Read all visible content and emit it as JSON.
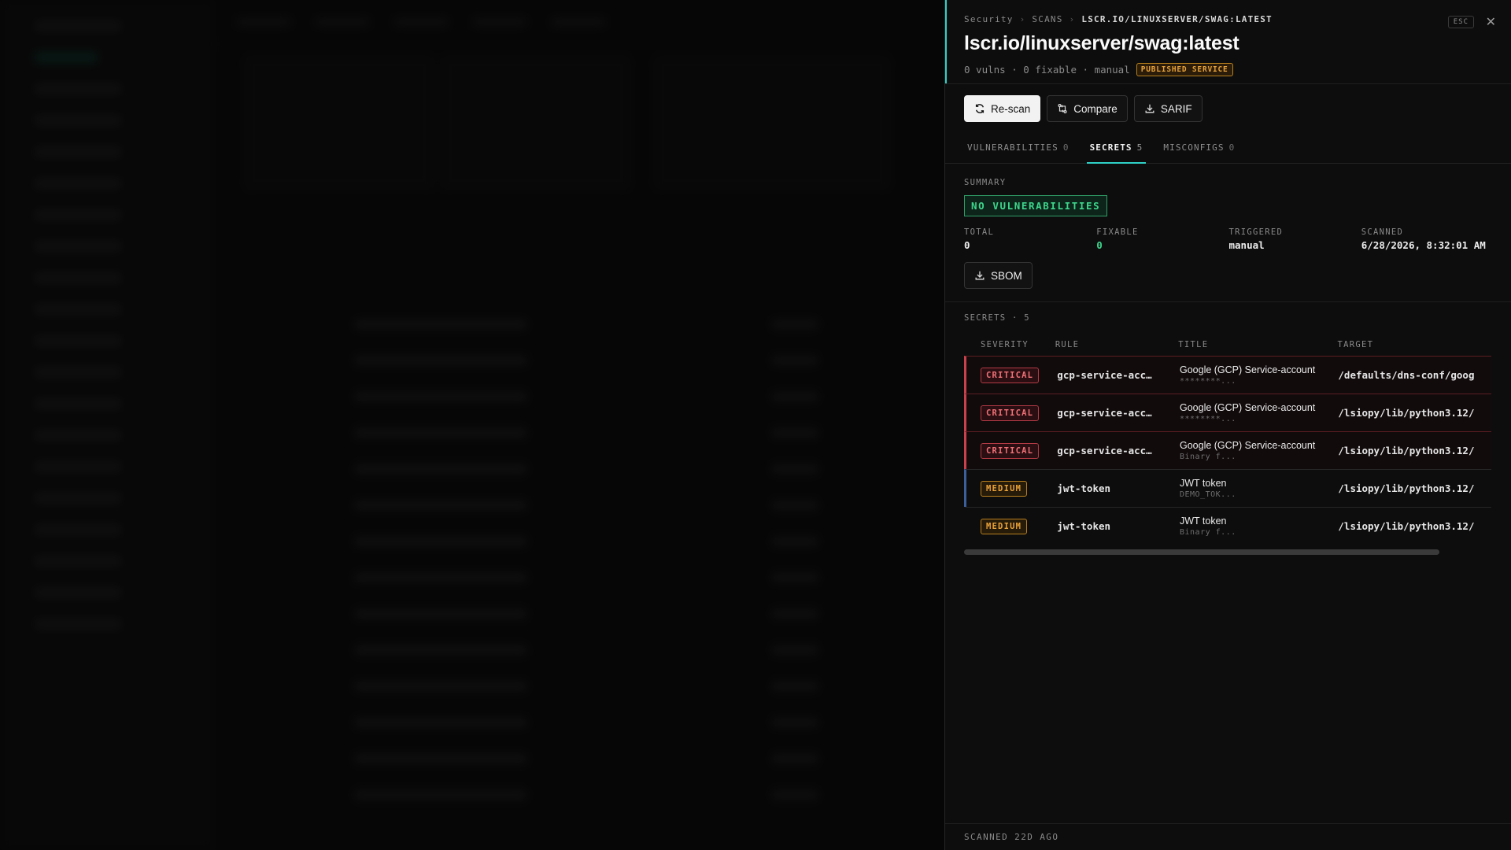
{
  "breadcrumb": {
    "root": "Security",
    "section": "SCANS",
    "current": "LSCR.IO/LINUXSERVER/SWAG:LATEST"
  },
  "header": {
    "title": "lscr.io/linuxserver/swag:latest",
    "meta": "0 vulns · 0 fixable · manual",
    "badge": "PUBLISHED SERVICE",
    "esc_label": "ESC",
    "close_icon": "close-icon"
  },
  "actions": {
    "rescan": "Re-scan",
    "compare": "Compare",
    "sarif": "SARIF"
  },
  "tabs": [
    {
      "label": "VULNERABILITIES",
      "count": "0"
    },
    {
      "label": "SECRETS",
      "count": "5"
    },
    {
      "label": "MISCONFIGS",
      "count": "0"
    }
  ],
  "summary": {
    "label": "SUMMARY",
    "status": "NO VULNERABILITIES",
    "stats": [
      {
        "label": "TOTAL",
        "value": "0"
      },
      {
        "label": "FIXABLE",
        "value": "0"
      },
      {
        "label": "TRIGGERED",
        "value": "manual"
      },
      {
        "label": "SCANNED",
        "value": "6/28/2026, 8:32:01 AM"
      }
    ],
    "sbom": "SBOM"
  },
  "secrets": {
    "heading": "SECRETS · 5",
    "columns": [
      "SEVERITY",
      "RULE",
      "TITLE",
      "TARGET"
    ],
    "rows": [
      {
        "severity": "CRITICAL",
        "rule": "gcp-service-acc…",
        "title": "Google (GCP) Service-account",
        "sub": "********...",
        "target": "/defaults/dns-conf/goog"
      },
      {
        "severity": "CRITICAL",
        "rule": "gcp-service-acc…",
        "title": "Google (GCP) Service-account",
        "sub": "********...",
        "target": "/lsiopy/lib/python3.12/"
      },
      {
        "severity": "CRITICAL",
        "rule": "gcp-service-acc…",
        "title": "Google (GCP) Service-account",
        "sub": "Binary f...",
        "target": "/lsiopy/lib/python3.12/"
      },
      {
        "severity": "MEDIUM",
        "rule": "jwt-token",
        "title": "JWT token",
        "sub": "DEMO_TOK...",
        "target": "/lsiopy/lib/python3.12/"
      },
      {
        "severity": "MEDIUM",
        "rule": "jwt-token",
        "title": "JWT token",
        "sub": "Binary f...",
        "target": "/lsiopy/lib/python3.12/"
      }
    ]
  },
  "footer": "SCANNED 22D AGO",
  "colors": {
    "accent": "#2fd1c7",
    "critical": "#f07178",
    "medium": "#e8a23a",
    "ok": "#3dd68c"
  }
}
